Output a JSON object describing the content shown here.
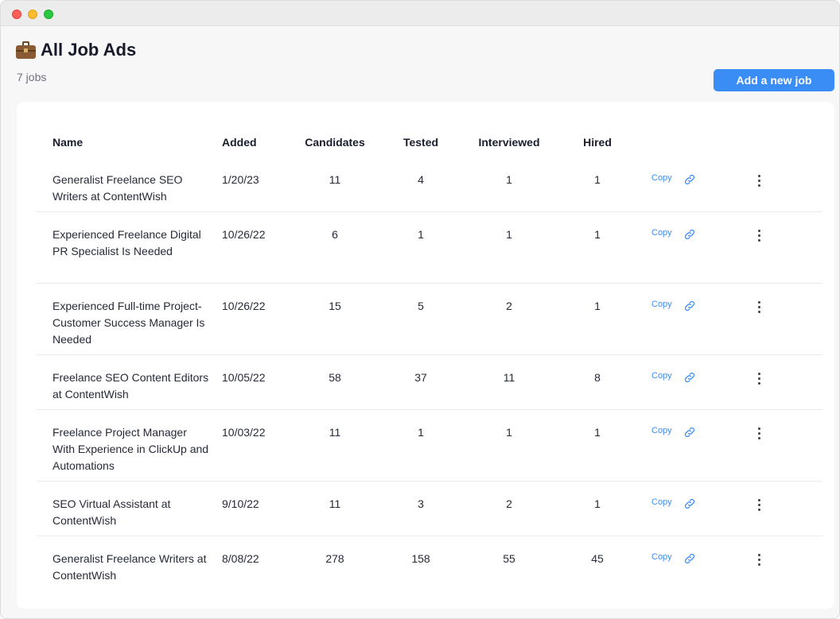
{
  "page": {
    "title": "All Job Ads",
    "title_icon": "briefcase-icon",
    "job_count": "7 jobs",
    "add_button_label": "Add a new job"
  },
  "table": {
    "headers": {
      "name": "Name",
      "added": "Added",
      "candidates": "Candidates",
      "tested": "Tested",
      "interviewed": "Interviewed",
      "hired": "Hired"
    },
    "copy_label": "Copy",
    "rows": [
      {
        "name": "Generalist Freelance SEO Writers at ContentWish",
        "added": "1/20/23",
        "candidates": "11",
        "tested": "4",
        "interviewed": "1",
        "hired": "1"
      },
      {
        "name": "Experienced Freelance Digital PR Specialist Is Needed",
        "added": "10/26/22",
        "candidates": "6",
        "tested": "1",
        "interviewed": "1",
        "hired": "1"
      },
      {
        "name": "Experienced Full-time Project-Customer Success Manager Is Needed",
        "added": "10/26/22",
        "candidates": "15",
        "tested": "5",
        "interviewed": "2",
        "hired": "1"
      },
      {
        "name": "Freelance SEO Content Editors at ContentWish",
        "added": "10/05/22",
        "candidates": "58",
        "tested": "37",
        "interviewed": "11",
        "hired": "8"
      },
      {
        "name": "Freelance Project Manager With Experience in ClickUp and Automations",
        "added": "10/03/22",
        "candidates": "11",
        "tested": "1",
        "interviewed": "1",
        "hired": "1"
      },
      {
        "name": "SEO Virtual Assistant at ContentWish",
        "added": "9/10/22",
        "candidates": "11",
        "tested": "3",
        "interviewed": "2",
        "hired": "1"
      },
      {
        "name": "Generalist Freelance Writers at ContentWish",
        "added": "8/08/22",
        "candidates": "278",
        "tested": "158",
        "interviewed": "55",
        "hired": "45"
      }
    ]
  },
  "colors": {
    "accent": "#3b8df6",
    "text": "#1f2230",
    "muted": "#6f7380"
  }
}
